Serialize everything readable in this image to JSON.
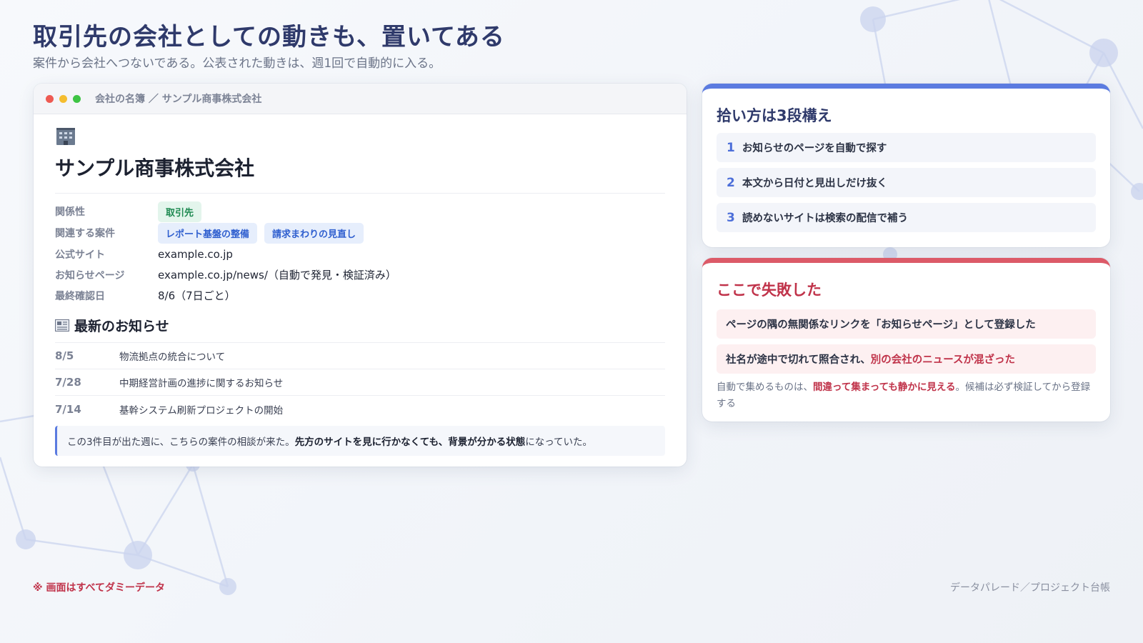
{
  "header": {
    "title": "取引先の会社としての動きも、置いてある",
    "subtitle": "案件から会社へつないである。公表された動きは、週1回で自動的に入る。"
  },
  "window": {
    "breadcrumb": "会社の名簿 ／ サンプル商事株式会社",
    "company_icon": "office-building-icon",
    "company_name": "サンプル商事株式会社",
    "properties": {
      "relation_key": "関係性",
      "relation_tag": "取引先",
      "projects_key": "関連する案件",
      "projects": [
        "レポート基盤の整備",
        "請求まわりの見直し"
      ],
      "site_key": "公式サイト",
      "site_val": "example.co.jp",
      "news_page_key": "お知らせページ",
      "news_page_val": "example.co.jp/news/（自動で発見・検証済み）",
      "last_checked_key": "最終確認日",
      "last_checked_val": "8/6（7日ごと）"
    },
    "news": {
      "icon": "newspaper-icon",
      "title": "最新のお知らせ",
      "items": [
        {
          "date": "8/5",
          "text": "物流拠点の統合について"
        },
        {
          "date": "7/28",
          "text": "中期経営計画の進捗に関するお知らせ"
        },
        {
          "date": "7/14",
          "text": "基幹システム刷新プロジェクトの開始"
        }
      ]
    },
    "callout": {
      "pre": "この3件目が出た週に、こちらの案件の相談が来た。",
      "bold": "先方のサイトを見に行かなくても、背景が分かる状態",
      "post": "になっていた。"
    }
  },
  "steps_card": {
    "title": "拾い方は3段構え",
    "accent": "#5b7be0",
    "items": [
      {
        "num": "1",
        "text": "お知らせのページを自動で探す"
      },
      {
        "num": "2",
        "text": "本文から日付と見出しだけ抜く"
      },
      {
        "num": "3",
        "text": "読めないサイトは検索の配信で補う"
      }
    ]
  },
  "fail_card": {
    "title": "ここで失敗した",
    "accent": "#dc5a68",
    "item1": "ページの隅の無関係なリンクを「お知らせページ」として登録した",
    "item2_pre": "社名が途中で切れて照合され、",
    "item2_hl": "別の会社のニュースが混ざった",
    "note_pre": "自動で集めるものは、",
    "note_hl": "間違って集まっても静かに見える",
    "note_post": "。候補は必ず検証してから登録する"
  },
  "footer": {
    "left": "※ 画面はすべてダミーデータ",
    "right": "データパレード／プロジェクト台帳"
  }
}
